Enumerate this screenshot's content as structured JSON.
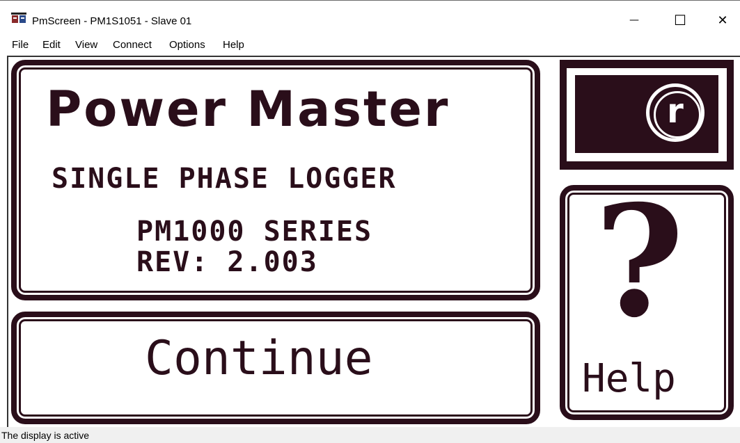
{
  "window": {
    "title": "PmScreen - PM1S1051 - Slave 01",
    "minimize_glyph": "—",
    "maximize_glyph": "☐",
    "close_glyph": "✕"
  },
  "menu": {
    "items": [
      "File",
      "Edit",
      "View",
      "Connect",
      "Options",
      "Help"
    ]
  },
  "splash": {
    "brand": "Power Master",
    "subtitle": "SINGLE PHASE LOGGER",
    "series": "PM1000 SERIES",
    "revision": "REV: 2.003"
  },
  "continue_button": {
    "label": "Continue"
  },
  "help_button": {
    "glyph": "?",
    "label": "Help"
  },
  "logo": {
    "glyph": "r"
  },
  "status": {
    "text": "The display is active"
  },
  "colors": {
    "lcd_dark": "#2a0e1a",
    "lcd_light": "#ffffff"
  }
}
